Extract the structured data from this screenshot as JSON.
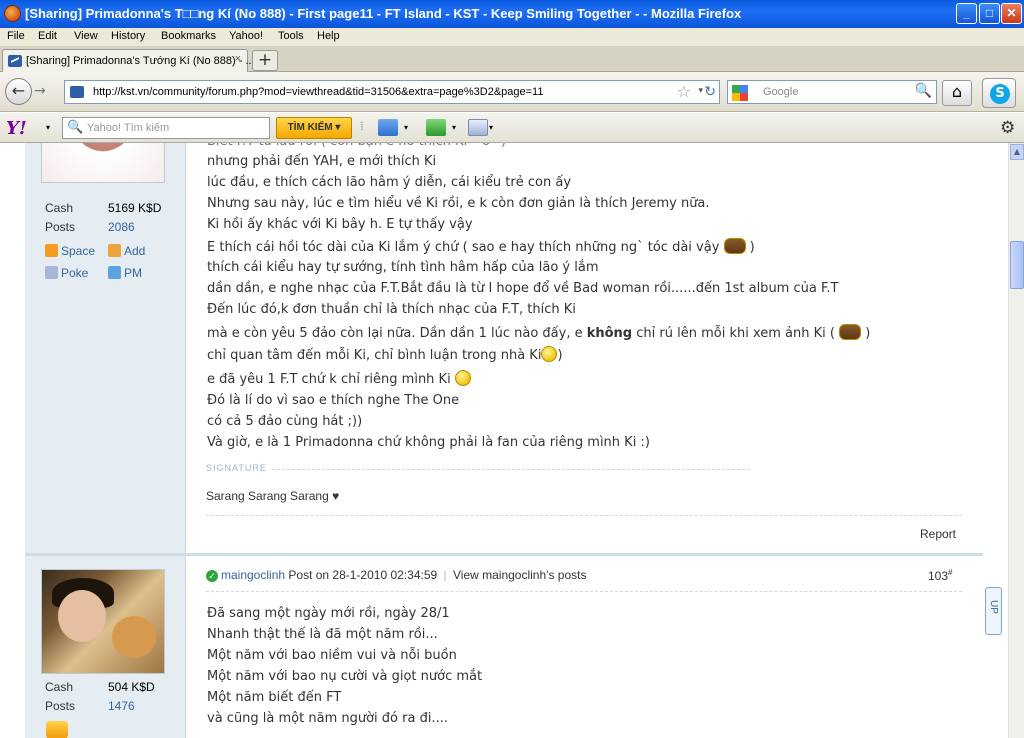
{
  "window": {
    "title": "[Sharing] Primadonna's T□□ng Kí (No 888) - First page11 - FT Island - KST - Keep Smiling Together - - Mozilla Firefox",
    "min": "_",
    "max": "□",
    "close": "✕"
  },
  "menu": [
    "File",
    "Edit",
    "View",
    "History",
    "Bookmarks",
    "Yahoo!",
    "Tools",
    "Help"
  ],
  "tab": {
    "label": "[Sharing] Primadonna's Tướng Kí (No 888) - ...",
    "close": "×",
    "new": "+"
  },
  "nav": {
    "back": "←",
    "forward": "→",
    "url": "http://kst.vn/community/forum.php?mod=viewthread&tid=31506&extra=page%3D2&page=11",
    "star": "☆",
    "dropdown": "▾",
    "reload": "↻",
    "search_placeholder": "Google",
    "search_icon": "🔍",
    "home": "⌂",
    "skype": "S"
  },
  "yahoo": {
    "logo": "Y!",
    "dd": "▾",
    "search_placeholder": "Yahoo! Tìm kiếm",
    "search_icon": "🔍",
    "search_button": "TÌM KIẾM ▾",
    "gear": "⚙"
  },
  "colors": {
    "accent": "#336699",
    "side_bg": "#e5edf2",
    "titlebar": "#0a5ae0"
  },
  "post1": {
    "stats": [
      {
        "label": "Cash",
        "value": "5169 K$D"
      },
      {
        "label": "Posts",
        "value": "2086"
      }
    ],
    "actions": {
      "space": "Space",
      "add": "Add",
      "poke": "Poke",
      "pm": "PM"
    },
    "lines": [
      "nhưng phải đến YAH, e mới thích Ki",
      "lúc đầu, e thích cách lão hâm ý diễn, cái kiểu trẻ con ấy",
      "Nhưng sau này, lúc e tìm hiểu về Ki rồi, e k còn đơn giản là thích Jeremy nữa.",
      "Ki hồi ấy khác với Ki bây h. E tự thấy vậy",
      "E thích cái hồi tóc dài của Ki lắm ý chứ ( sao e hay thích những ng` tóc dài vậy",
      "thích cái kiểu hay tự sướng, tính tình hâm hấp của lão ý lắm",
      "dần dần, e nghe nhạc của F.T.Bắt đầu là từ I hope đổ về Bad woman rồi......đến 1st album của F.T",
      "Đến lúc đó,k đơn thuần chỉ là thích nhạc của F.T, thích Ki",
      "mà e còn yêu 5 đảo còn lại nữa. Dần dần 1 lúc nào đấy, e",
      "không",
      "chỉ rú lên mỗi khi xem ảnh  Ki (",
      "chỉ quan tâm đến mỗi Ki, chỉ bình luận trong nhà Ki",
      "e đã yêu 1 F.T chứ k chỉ riêng mình Ki",
      "Đó là lí do vì sao e thích nghe The One",
      "có cả 5 đảo cùng hát ;))",
      "Và giờ, e là 1 Primadonna chứ không phải là fan của riêng mình Ki :)"
    ],
    "signature_label": "SIGNATURE",
    "signature": "Sarang Sarang Sarang ♥",
    "report": "Report"
  },
  "post2": {
    "stats": [
      {
        "label": "Cash",
        "value": "504 K$D"
      },
      {
        "label": "Posts",
        "value": "1476"
      }
    ],
    "author": "maingoclinh",
    "posted": "Post on 28-1-2010 02:34:59",
    "view_posts": "View maingoclinh's posts",
    "number": "103",
    "number_sup": "#",
    "up": "UP",
    "lines": [
      "Đã sang một ngày mới rồi, ngày 28/1",
      "Nhanh thật thế là đã một năm rồi...",
      "Một năm với bao niềm vui và nỗi buồn",
      "Một năm với bao nụ cười và giọt nước mắt",
      "Một năm biết đến FT",
      "và cũng là một năm người đó ra đi...."
    ]
  }
}
